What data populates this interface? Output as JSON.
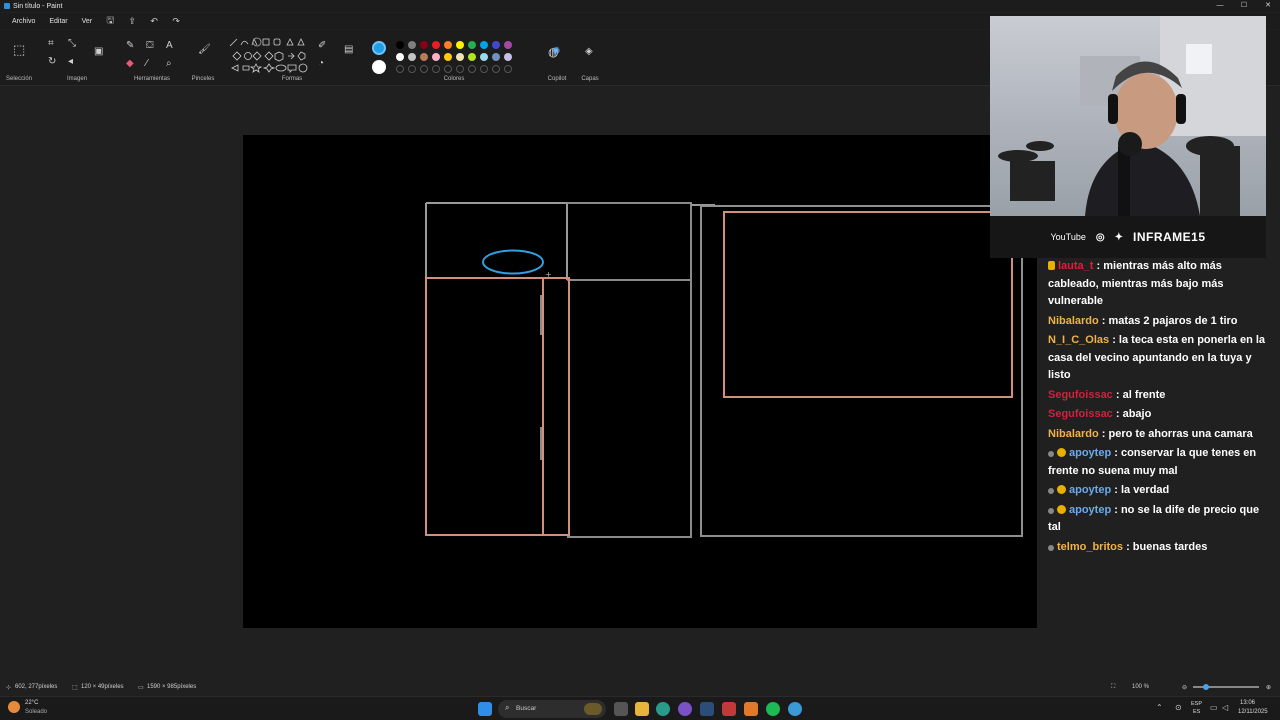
{
  "window": {
    "title": "Sin título - Paint",
    "controls": [
      "—",
      "☐",
      "✕"
    ]
  },
  "menu": {
    "items": [
      "Archivo",
      "Editar",
      "Ver"
    ]
  },
  "ribbon": {
    "groups": [
      "Selección",
      "Imagen",
      "Herramientas",
      "Pinceles",
      "Formas",
      "Colores",
      "Copilot",
      "Capas"
    ]
  },
  "colors": {
    "primary": "#1e9fe0",
    "secondary": "#ffffff",
    "palette_row1": [
      "#000000",
      "#7f7f7f",
      "#880015",
      "#ed1c24",
      "#ff7f27",
      "#fff200",
      "#22b14c",
      "#00a2e8",
      "#3f48cc",
      "#a349a4"
    ],
    "palette_row2": [
      "#ffffff",
      "#c3c3c3",
      "#b97a57",
      "#ffaec9",
      "#ffc90e",
      "#efe4b0",
      "#b5e61d",
      "#99d9ea",
      "#7092be",
      "#c8bfe7"
    ]
  },
  "statusbar": {
    "cursor": "602, 277píxeles",
    "selection": "120 × 49píxeles",
    "canvas_size": "1590 × 985píxeles",
    "zoom": "100 %"
  },
  "taskbar": {
    "weather_temp": "22°C",
    "weather_desc": "Soleado",
    "search_placeholder": "Buscar",
    "lang_top": "ESP",
    "lang_bottom": "ES",
    "time": "13:06",
    "date": "12/11/2025"
  },
  "stream": {
    "brand_youtube": "YouTube",
    "brand_name": "INFRAME15"
  },
  "chat": [
    {
      "user": "lauta_t",
      "color": "#e8193c",
      "badge": "gold",
      "text": ": mientras más alto más cableado, mientras más bajo más vulnerable"
    },
    {
      "user": "Nibalardo",
      "color": "#f0b34a",
      "badge": "",
      "text": ": matas 2 pajaros de 1 tiro"
    },
    {
      "user": "N_I_C_Olas",
      "color": "#f0b34a",
      "badge": "",
      "text": ": la teca esta en ponerla en la casa del vecino apuntando en la tuya y listo"
    },
    {
      "user": "Segufoissac",
      "color": "#d0213f",
      "badge": "",
      "text": ": al frente"
    },
    {
      "user": "Segufoissac",
      "color": "#d0213f",
      "badge": "",
      "text": ": abajo"
    },
    {
      "user": "Nibalardo",
      "color": "#f0b34a",
      "badge": "",
      "text": ": pero te ahorras una camara"
    },
    {
      "user": "apoytep",
      "color": "#6aaaf0",
      "badge": "both",
      "text": ": conservar la que tenes en frente no suena muy mal"
    },
    {
      "user": "apoytep",
      "color": "#6aaaf0",
      "badge": "both",
      "text": ": la verdad"
    },
    {
      "user": "apoytep",
      "color": "#6aaaf0",
      "badge": "both",
      "text": ": no se la dife de precio que tal"
    },
    {
      "user": "telmo_britos",
      "color": "#f0b34a",
      "badge": "small",
      "text": ": buenas tardes"
    }
  ]
}
